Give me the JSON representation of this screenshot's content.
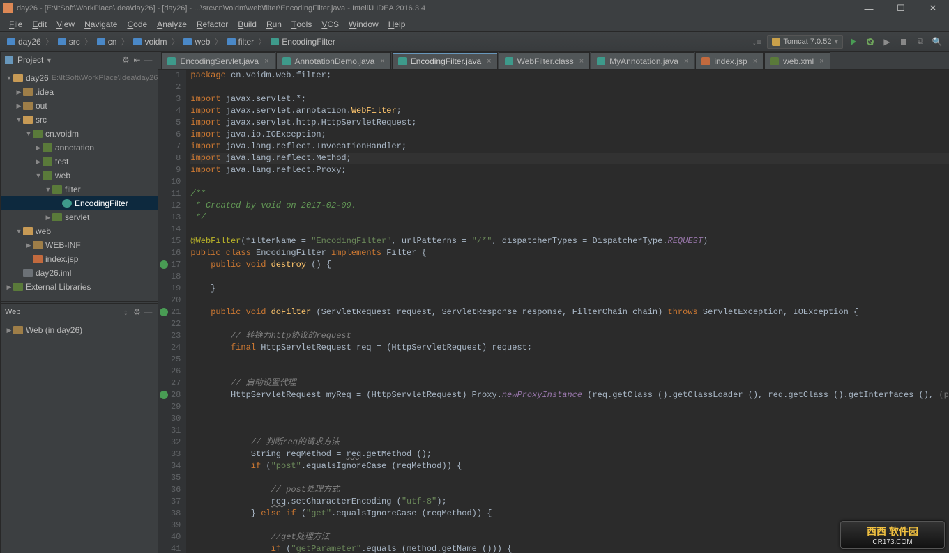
{
  "window": {
    "title": "day26 - [E:\\ItSoft\\WorkPlace\\Idea\\day26] - [day26] - ...\\src\\cn\\voidm\\web\\filter\\EncodingFilter.java - IntelliJ IDEA 2016.3.4",
    "minimize_label": "—",
    "maximize_label": "☐",
    "close_label": "✕"
  },
  "menubar": [
    "File",
    "Edit",
    "View",
    "Navigate",
    "Code",
    "Analyze",
    "Refactor",
    "Build",
    "Run",
    "Tools",
    "VCS",
    "Window",
    "Help"
  ],
  "breadcrumbs": [
    {
      "label": "day26",
      "icon": "folder"
    },
    {
      "label": "src",
      "icon": "folder"
    },
    {
      "label": "cn",
      "icon": "folder"
    },
    {
      "label": "voidm",
      "icon": "folder"
    },
    {
      "label": "web",
      "icon": "folder"
    },
    {
      "label": "filter",
      "icon": "folder"
    },
    {
      "label": "EncodingFilter",
      "icon": "class"
    }
  ],
  "run_config": {
    "label": "Tomcat 7.0.52",
    "chevron": "▾"
  },
  "project_panel": {
    "title": "Project",
    "tree": [
      {
        "depth": 0,
        "twisty": "▼",
        "icon": "folder-open",
        "label": "day26",
        "dim": "E:\\ItSoft\\WorkPlace\\Idea\\day26"
      },
      {
        "depth": 1,
        "twisty": "▶",
        "icon": "folder",
        "label": ".idea"
      },
      {
        "depth": 1,
        "twisty": "▶",
        "icon": "folder",
        "label": "out"
      },
      {
        "depth": 1,
        "twisty": "▼",
        "icon": "folder-open",
        "label": "src"
      },
      {
        "depth": 2,
        "twisty": "▼",
        "icon": "pkg",
        "label": "cn.voidm"
      },
      {
        "depth": 3,
        "twisty": "▶",
        "icon": "pkg",
        "label": "annotation"
      },
      {
        "depth": 3,
        "twisty": "▶",
        "icon": "pkg",
        "label": "test"
      },
      {
        "depth": 3,
        "twisty": "▼",
        "icon": "pkg",
        "label": "web"
      },
      {
        "depth": 4,
        "twisty": "▼",
        "icon": "pkg",
        "label": "filter"
      },
      {
        "depth": 5,
        "twisty": "",
        "icon": "class",
        "label": "EncodingFilter",
        "selected": true
      },
      {
        "depth": 4,
        "twisty": "▶",
        "icon": "pkg",
        "label": "servlet"
      },
      {
        "depth": 1,
        "twisty": "▼",
        "icon": "folder-open",
        "label": "web"
      },
      {
        "depth": 2,
        "twisty": "▶",
        "icon": "folder",
        "label": "WEB-INF"
      },
      {
        "depth": 2,
        "twisty": "",
        "icon": "jsp",
        "label": "index.jsp"
      },
      {
        "depth": 1,
        "twisty": "",
        "icon": "file",
        "label": "day26.iml"
      },
      {
        "depth": 0,
        "twisty": "▶",
        "icon": "lib",
        "label": "External Libraries"
      }
    ]
  },
  "web_panel": {
    "title": "Web",
    "item": "Web (in day26)"
  },
  "tabs": [
    {
      "label": "EncodingServlet.java",
      "icon": "class",
      "active": false
    },
    {
      "label": "AnnotationDemo.java",
      "icon": "class",
      "active": false
    },
    {
      "label": "EncodingFilter.java",
      "icon": "class",
      "active": true
    },
    {
      "label": "WebFilter.class",
      "icon": "class",
      "active": false
    },
    {
      "label": "MyAnnotation.java",
      "icon": "class",
      "active": false
    },
    {
      "label": "index.jsp",
      "icon": "jsp",
      "active": false
    },
    {
      "label": "web.xml",
      "icon": "xml",
      "active": false
    }
  ],
  "editor": {
    "lines": [
      {
        "n": 1,
        "html": "<span class='kw'>package</span> cn.voidm.web.filter;"
      },
      {
        "n": 2,
        "html": ""
      },
      {
        "n": 3,
        "html": "<span class='kw'>import</span> javax.servlet.*;"
      },
      {
        "n": 4,
        "html": "<span class='kw'>import</span> javax.servlet.annotation.<span class='fn'>WebFilter</span>;"
      },
      {
        "n": 5,
        "html": "<span class='kw'>import</span> javax.servlet.http.HttpServletRequest;"
      },
      {
        "n": 6,
        "html": "<span class='kw'>import</span> java.io.IOException;"
      },
      {
        "n": 7,
        "html": "<span class='kw'>import</span> java.lang.reflect.InvocationHandler;"
      },
      {
        "n": 8,
        "html": "<span class='kw'>import</span> java.lang.reflect.Method;",
        "hl": true
      },
      {
        "n": 9,
        "html": "<span class='kw'>import</span> java.lang.reflect.Proxy;"
      },
      {
        "n": 10,
        "html": ""
      },
      {
        "n": 11,
        "html": "<span class='cmtg'>/**</span>"
      },
      {
        "n": 12,
        "html": "<span class='cmtg'> * Created by void on 2017-02-09.</span>"
      },
      {
        "n": 13,
        "html": "<span class='cmtg'> */</span>"
      },
      {
        "n": 14,
        "html": ""
      },
      {
        "n": 15,
        "html": "<span class='ann'>@WebFilter</span>(filterName = <span class='str'>\"EncodingFilter\"</span>, urlPatterns = <span class='str'>\"/*\"</span>, dispatcherTypes = DispatcherType.<span class='it'>REQUEST</span>)"
      },
      {
        "n": 16,
        "html": "<span class='kw'>public class</span> EncodingFilter <span class='kw'>implements</span> Filter {"
      },
      {
        "n": 17,
        "html": "    <span class='kw'>public void</span> <span class='fn'>destroy</span> () {",
        "mark": true
      },
      {
        "n": 18,
        "html": ""
      },
      {
        "n": 19,
        "html": "    }"
      },
      {
        "n": 20,
        "html": ""
      },
      {
        "n": 21,
        "html": "    <span class='kw'>public void</span> <span class='fn'>doFilter</span> (ServletRequest request, ServletResponse response, FilterChain chain) <span class='kw'>throws</span> ServletException, IOException {",
        "mark": true
      },
      {
        "n": 22,
        "html": ""
      },
      {
        "n": 23,
        "html": "        <span class='cmt'>// 转换为http协议的request</span>"
      },
      {
        "n": 24,
        "html": "        <span class='kw'>final</span> HttpServletRequest req = (HttpServletRequest) request;"
      },
      {
        "n": 25,
        "html": ""
      },
      {
        "n": 26,
        "html": ""
      },
      {
        "n": 27,
        "html": "        <span class='cmt'>// 启动设置代理</span>"
      },
      {
        "n": 28,
        "html": "        HttpServletRequest myReq = (HttpServletRequest) Proxy.<span class='it'>newProxyInstance</span> (req.getClass ().getClassLoader (), req.getClass ().getInterfaces (), <span class='dim2'>(proxy, method, args) -&gt; {</span>",
        "mark": true
      },
      {
        "n": 29,
        "html": ""
      },
      {
        "n": 30,
        "html": ""
      },
      {
        "n": 31,
        "html": ""
      },
      {
        "n": 32,
        "html": "            <span class='cmt'>// 判断req的请求方法</span>"
      },
      {
        "n": 33,
        "html": "            String reqMethod = <span class='warn'>req</span>.getMethod ();"
      },
      {
        "n": 34,
        "html": "            <span class='kw'>if</span> (<span class='str'>\"post\"</span>.equalsIgnoreCase (reqMethod)) {"
      },
      {
        "n": 35,
        "html": ""
      },
      {
        "n": 36,
        "html": "                <span class='cmt'>// post处理方式</span>"
      },
      {
        "n": 37,
        "html": "                <span class='warn'>req</span>.setCharacterEncoding (<span class='str'>\"utf-8\"</span>);"
      },
      {
        "n": 38,
        "html": "            } <span class='kw'>else if</span> (<span class='str'>\"get\"</span>.equalsIgnoreCase (reqMethod)) {"
      },
      {
        "n": 39,
        "html": ""
      },
      {
        "n": 40,
        "html": "                <span class='cmt'>//get处理方法</span>"
      },
      {
        "n": 41,
        "html": "                <span class='kw'>if</span> (<span class='str'>\"getParameter\"</span>.equals (method.getName ())) {"
      }
    ]
  },
  "watermark": {
    "name": "西西 软件园",
    "url": "CR173.COM"
  }
}
